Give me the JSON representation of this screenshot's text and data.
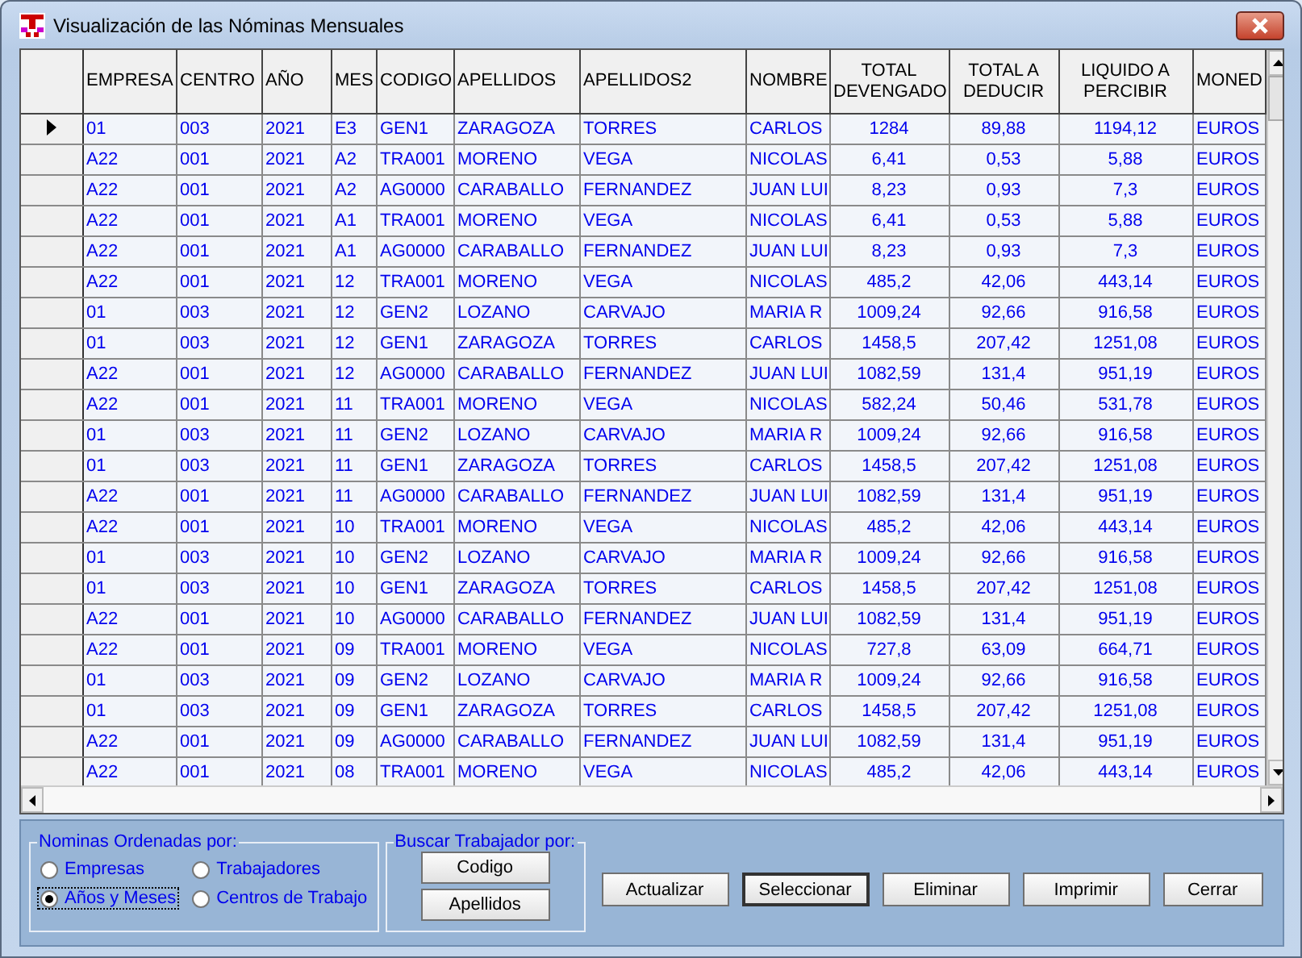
{
  "window": {
    "title": "Visualización de las Nóminas  Mensuales"
  },
  "table": {
    "columns": [
      {
        "label": "EMPRESA",
        "kind": "text"
      },
      {
        "label": "CENTRO",
        "kind": "text"
      },
      {
        "label": "AÑO",
        "kind": "text"
      },
      {
        "label": "MES",
        "kind": "text"
      },
      {
        "label": "CODIGO",
        "kind": "text"
      },
      {
        "label": "APELLIDOS",
        "kind": "text"
      },
      {
        "label": "APELLIDOS2",
        "kind": "text"
      },
      {
        "label": "NOMBRE",
        "kind": "text"
      },
      {
        "label": "TOTAL DEVENGADO",
        "kind": "amount"
      },
      {
        "label": "TOTAL A DEDUCIR",
        "kind": "amount"
      },
      {
        "label": "LIQUIDO A PERCIBIR",
        "kind": "amount"
      },
      {
        "label": "MONED",
        "kind": "text"
      }
    ],
    "rows": [
      {
        "current": true,
        "cells": [
          "01",
          "003",
          "2021",
          "E3",
          "GEN1",
          "ZARAGOZA",
          "TORRES",
          "CARLOS",
          "1284",
          "89,88",
          "1194,12",
          "EUROS"
        ]
      },
      {
        "current": false,
        "cells": [
          "A22",
          "001",
          "2021",
          "A2",
          "TRA001",
          "MORENO",
          "VEGA",
          "NICOLAS",
          "6,41",
          "0,53",
          "5,88",
          "EUROS"
        ]
      },
      {
        "current": false,
        "cells": [
          "A22",
          "001",
          "2021",
          "A2",
          "AG0000",
          "CARABALLO",
          "FERNANDEZ",
          "JUAN LUI",
          "8,23",
          "0,93",
          "7,3",
          "EUROS"
        ]
      },
      {
        "current": false,
        "cells": [
          "A22",
          "001",
          "2021",
          "A1",
          "TRA001",
          "MORENO",
          "VEGA",
          "NICOLAS",
          "6,41",
          "0,53",
          "5,88",
          "EUROS"
        ]
      },
      {
        "current": false,
        "cells": [
          "A22",
          "001",
          "2021",
          "A1",
          "AG0000",
          "CARABALLO",
          "FERNANDEZ",
          "JUAN LUI",
          "8,23",
          "0,93",
          "7,3",
          "EUROS"
        ]
      },
      {
        "current": false,
        "cells": [
          "A22",
          "001",
          "2021",
          "12",
          "TRA001",
          "MORENO",
          "VEGA",
          "NICOLAS",
          "485,2",
          "42,06",
          "443,14",
          "EUROS"
        ]
      },
      {
        "current": false,
        "cells": [
          "01",
          "003",
          "2021",
          "12",
          "GEN2",
          "LOZANO",
          "CARVAJO",
          "MARIA R",
          "1009,24",
          "92,66",
          "916,58",
          "EUROS"
        ]
      },
      {
        "current": false,
        "cells": [
          "01",
          "003",
          "2021",
          "12",
          "GEN1",
          "ZARAGOZA",
          "TORRES",
          "CARLOS",
          "1458,5",
          "207,42",
          "1251,08",
          "EUROS"
        ]
      },
      {
        "current": false,
        "cells": [
          "A22",
          "001",
          "2021",
          "12",
          "AG0000",
          "CARABALLO",
          "FERNANDEZ",
          "JUAN LUI",
          "1082,59",
          "131,4",
          "951,19",
          "EUROS"
        ]
      },
      {
        "current": false,
        "cells": [
          "A22",
          "001",
          "2021",
          "11",
          "TRA001",
          "MORENO",
          "VEGA",
          "NICOLAS",
          "582,24",
          "50,46",
          "531,78",
          "EUROS"
        ]
      },
      {
        "current": false,
        "cells": [
          "01",
          "003",
          "2021",
          "11",
          "GEN2",
          "LOZANO",
          "CARVAJO",
          "MARIA R",
          "1009,24",
          "92,66",
          "916,58",
          "EUROS"
        ]
      },
      {
        "current": false,
        "cells": [
          "01",
          "003",
          "2021",
          "11",
          "GEN1",
          "ZARAGOZA",
          "TORRES",
          "CARLOS",
          "1458,5",
          "207,42",
          "1251,08",
          "EUROS"
        ]
      },
      {
        "current": false,
        "cells": [
          "A22",
          "001",
          "2021",
          "11",
          "AG0000",
          "CARABALLO",
          "FERNANDEZ",
          "JUAN LUI",
          "1082,59",
          "131,4",
          "951,19",
          "EUROS"
        ]
      },
      {
        "current": false,
        "cells": [
          "A22",
          "001",
          "2021",
          "10",
          "TRA001",
          "MORENO",
          "VEGA",
          "NICOLAS",
          "485,2",
          "42,06",
          "443,14",
          "EUROS"
        ]
      },
      {
        "current": false,
        "cells": [
          "01",
          "003",
          "2021",
          "10",
          "GEN2",
          "LOZANO",
          "CARVAJO",
          "MARIA R",
          "1009,24",
          "92,66",
          "916,58",
          "EUROS"
        ]
      },
      {
        "current": false,
        "cells": [
          "01",
          "003",
          "2021",
          "10",
          "GEN1",
          "ZARAGOZA",
          "TORRES",
          "CARLOS",
          "1458,5",
          "207,42",
          "1251,08",
          "EUROS"
        ]
      },
      {
        "current": false,
        "cells": [
          "A22",
          "001",
          "2021",
          "10",
          "AG0000",
          "CARABALLO",
          "FERNANDEZ",
          "JUAN LUI",
          "1082,59",
          "131,4",
          "951,19",
          "EUROS"
        ]
      },
      {
        "current": false,
        "cells": [
          "A22",
          "001",
          "2021",
          "09",
          "TRA001",
          "MORENO",
          "VEGA",
          "NICOLAS",
          "727,8",
          "63,09",
          "664,71",
          "EUROS"
        ]
      },
      {
        "current": false,
        "cells": [
          "01",
          "003",
          "2021",
          "09",
          "GEN2",
          "LOZANO",
          "CARVAJO",
          "MARIA R",
          "1009,24",
          "92,66",
          "916,58",
          "EUROS"
        ]
      },
      {
        "current": false,
        "cells": [
          "01",
          "003",
          "2021",
          "09",
          "GEN1",
          "ZARAGOZA",
          "TORRES",
          "CARLOS",
          "1458,5",
          "207,42",
          "1251,08",
          "EUROS"
        ]
      },
      {
        "current": false,
        "cells": [
          "A22",
          "001",
          "2021",
          "09",
          "AG0000",
          "CARABALLO",
          "FERNANDEZ",
          "JUAN LUI",
          "1082,59",
          "131,4",
          "951,19",
          "EUROS"
        ]
      },
      {
        "current": false,
        "cells": [
          "A22",
          "001",
          "2021",
          "08",
          "TRA001",
          "MORENO",
          "VEGA",
          "NICOLAS",
          "485,2",
          "42,06",
          "443,14",
          "EUROS"
        ]
      }
    ]
  },
  "order_group": {
    "title": "Nominas Ordenadas por:",
    "options": [
      {
        "label": "Empresas",
        "selected": false,
        "focused": false
      },
      {
        "label": "Trabajadores",
        "selected": false,
        "focused": false
      },
      {
        "label": "Años y Meses",
        "selected": true,
        "focused": true
      },
      {
        "label": "Centros de Trabajo",
        "selected": false,
        "focused": false
      }
    ]
  },
  "search_group": {
    "title": "Buscar Trabajador  por:",
    "buttons": [
      "Codigo",
      "Apellidos"
    ]
  },
  "buttons": [
    {
      "label": "Actualizar",
      "default": false
    },
    {
      "label": "Seleccionar",
      "default": true
    },
    {
      "label": "Eliminar",
      "default": false
    },
    {
      "label": "Imprimir",
      "default": false
    },
    {
      "label": "Cerrar",
      "default": false
    }
  ]
}
